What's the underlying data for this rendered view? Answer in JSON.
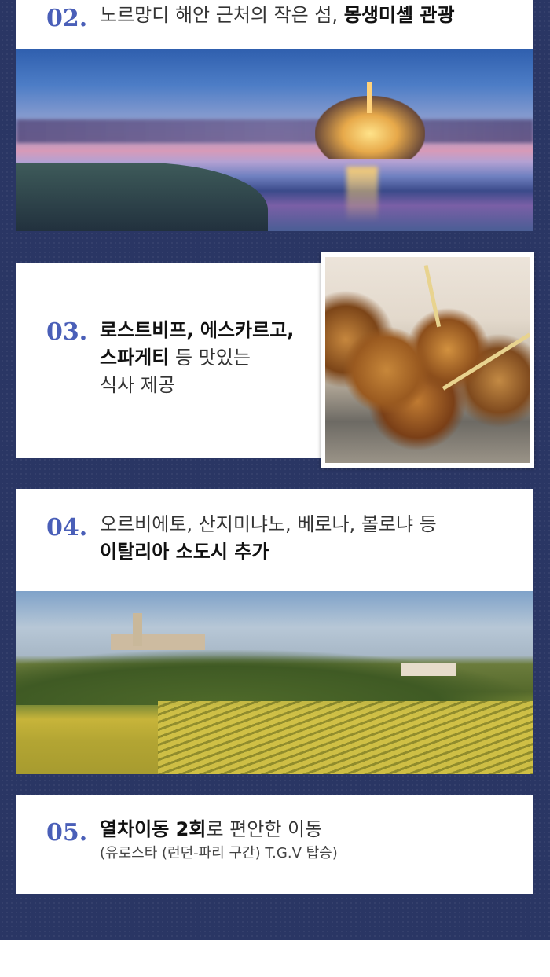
{
  "items": [
    {
      "number": "02.",
      "text_plain": "노르망디 해안 근처의 작은 섬, ",
      "text_bold": "몽생미셸 관광",
      "image": "mont-saint-michel-photo"
    },
    {
      "number": "03.",
      "line1_bold": "로스트비프, 에스카르고,",
      "line2_bold": "스파게티",
      "line2_plain": " 등 맛있는",
      "line3_plain": "식사 제공",
      "image": "escargot-photo"
    },
    {
      "number": "04.",
      "line1_plain": "오르비에토, 산지미냐노, 베로나, 볼로냐 등",
      "line2_bold": "이탈리아 소도시 추가",
      "image": "tuscany-landscape-photo"
    },
    {
      "number": "05.",
      "line1_bold": "열차이동 2회",
      "line1_plain": "로 편안한 이동",
      "line2_small": "(유로스타 (런던-파리 구간) T.G.V 탑승)"
    }
  ],
  "colors": {
    "navy_background": "#2a3664",
    "number_accent": "#4a5fb8"
  }
}
